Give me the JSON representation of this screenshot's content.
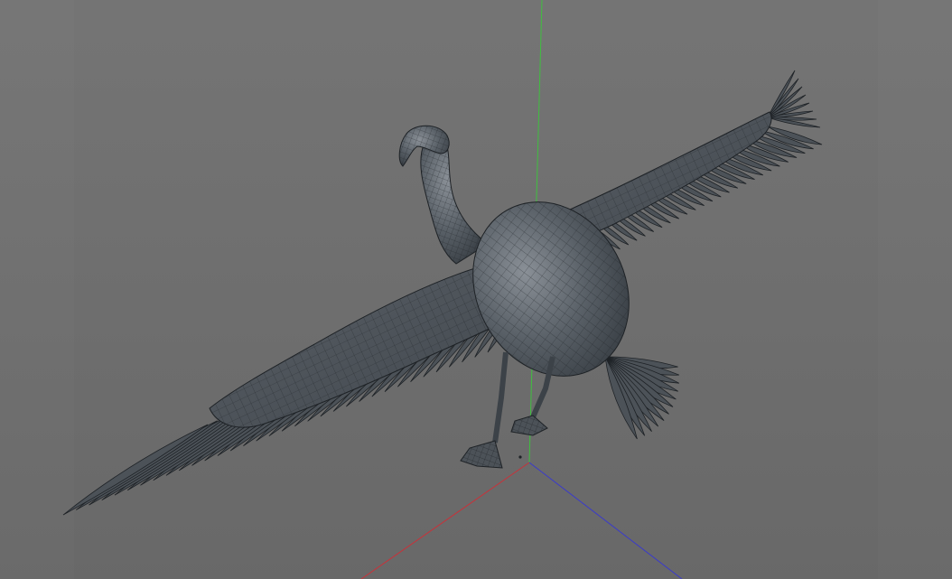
{
  "viewport": {
    "mode": "perspective-3d-viewport",
    "shading": "gouraud-with-wireframe",
    "model": "bird-with-spread-wings"
  },
  "axes": {
    "x_color": "#c8323a",
    "y_color": "#3fbf3f",
    "z_color": "#3a3acb"
  },
  "colors": {
    "background_top": "#7a7a7a",
    "background_bottom": "#666666",
    "model_fill": "#4c5258",
    "model_highlight": "#8a9097",
    "wireframe": "#1e2226"
  }
}
